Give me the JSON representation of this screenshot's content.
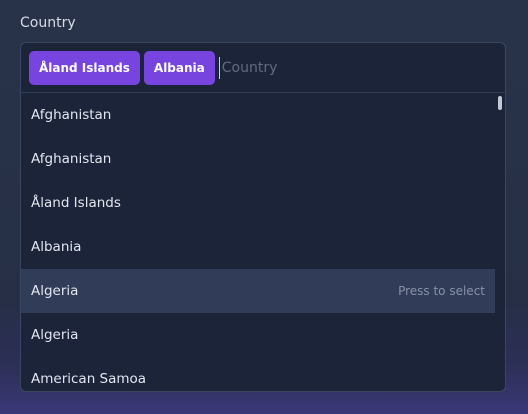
{
  "field": {
    "label": "Country"
  },
  "selected_chips": [
    {
      "label": "Åland Islands"
    },
    {
      "label": "Albania"
    }
  ],
  "search": {
    "value": "",
    "placeholder": "Country"
  },
  "options": [
    {
      "label": "Afghanistan"
    },
    {
      "label": "Afghanistan"
    },
    {
      "label": "Åland Islands"
    },
    {
      "label": "Albania"
    },
    {
      "label": "Algeria",
      "hint": "Press to select",
      "focused": true
    },
    {
      "label": "Algeria"
    },
    {
      "label": "American Samoa"
    }
  ],
  "colors": {
    "chip_background": "#7744e0",
    "focused_option_background": "#303c58",
    "panel_background": "#1b2439"
  }
}
